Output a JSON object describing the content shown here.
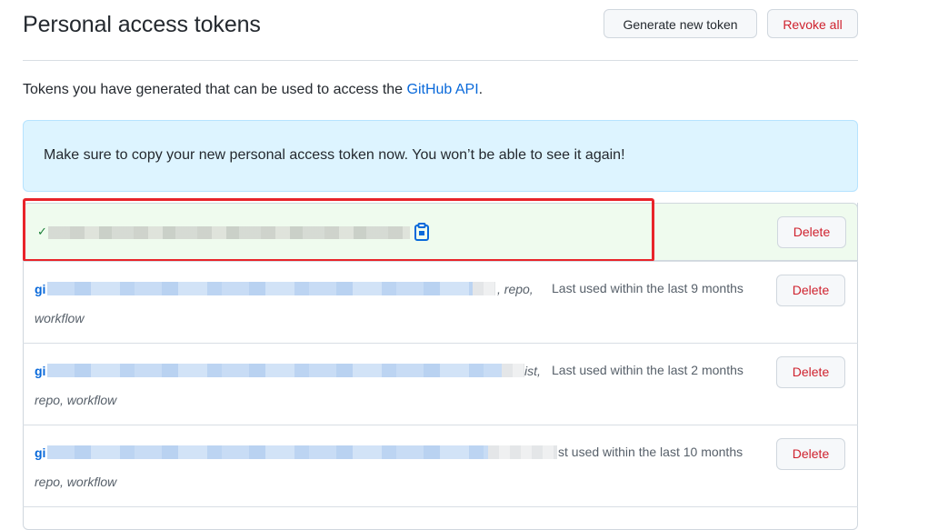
{
  "header": {
    "title": "Personal access tokens",
    "generate_label": "Generate new token",
    "revoke_label": "Revoke all"
  },
  "intro": {
    "text_before": "Tokens you have generated that can be used to access the ",
    "link_text": "GitHub API",
    "text_after": "."
  },
  "flash": {
    "message": "Make sure to copy your new personal access token now. You won’t be able to see it again!"
  },
  "new_token": {
    "check_glyph": "✓",
    "delete_label": "Delete"
  },
  "tokens": [
    {
      "name_prefix": "gi",
      "scope_tail": ", repo,",
      "scope_line2": "workflow",
      "last_used": "Last used within the last 9 months",
      "delete_label": "Delete"
    },
    {
      "name_prefix": "gi",
      "scope_tail": "ist,",
      "scope_line2": "repo, workflow",
      "last_used": "Last used within the last 2 months",
      "delete_label": "Delete"
    },
    {
      "name_prefix": "gi",
      "scope_tail": "",
      "scope_line2": "repo, workflow",
      "last_used": "st used within the last 10 months",
      "delete_label": "Delete"
    }
  ],
  "colors": {
    "link": "#0969da",
    "danger": "#cf222e",
    "flash_bg": "#ddf4ff",
    "new_token_bg": "#effbee",
    "highlight_border": "#e8242a"
  }
}
